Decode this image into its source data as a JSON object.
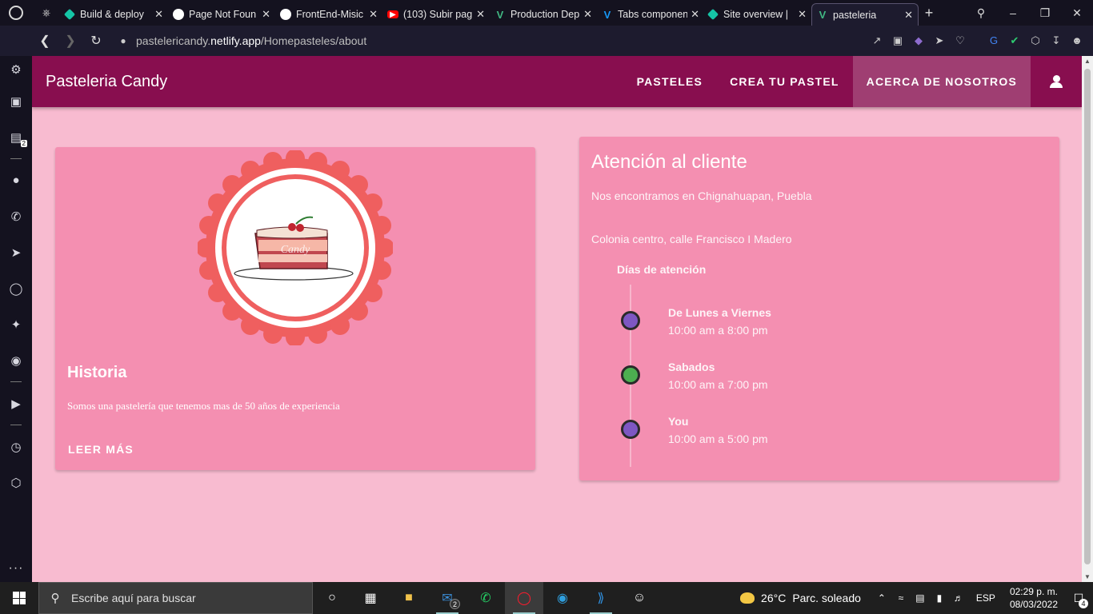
{
  "browser": {
    "tabs": [
      {
        "label": "Build & deploy",
        "icon": "netlify-icon",
        "color": "#15c5a6"
      },
      {
        "label": "Page Not Foun",
        "icon": "globe-icon",
        "color": "#ffffff"
      },
      {
        "label": "FrontEnd-Misic",
        "icon": "github-icon",
        "color": "#ffffff"
      },
      {
        "label": "(103) Subir pag",
        "icon": "youtube-icon",
        "color": "#ff0000"
      },
      {
        "label": "Production Dep",
        "icon": "vue-icon",
        "color": "#41b883"
      },
      {
        "label": "Tabs componen",
        "icon": "vuetify-icon",
        "color": "#1697f6"
      },
      {
        "label": "Site overview |",
        "icon": "netlify-icon",
        "color": "#15c5a6"
      },
      {
        "label": "pasteleria",
        "icon": "vue-icon",
        "color": "#41b883"
      }
    ],
    "url_prefix": "pastelericandy.",
    "url_host": "netlify.app",
    "url_path": "/Homepasteles/about"
  },
  "sidebar": {
    "twitch_badge": "2"
  },
  "app": {
    "brand": "Pasteleria Candy",
    "nav": {
      "pasteles": "PASTELES",
      "crea": "CREA TU PASTEL",
      "acerca": "ACERCA DE NOSOTROS"
    },
    "primary_color": "#880e4f",
    "background_color": "#f8bbd0",
    "card_color": "#f48fb1"
  },
  "historia": {
    "logo_text": "Candy",
    "title": "Historia",
    "text": "Somos una pastelería que tenemos mas de 50 años de experiencia",
    "button": "LEER MÁS"
  },
  "atencion": {
    "title": "Atención al cliente",
    "line1": "Nos encontramos en Chignahuapan, Puebla",
    "line2": "Colonia centro, calle Francisco I Madero",
    "schedule_title": "Días de atención",
    "schedule": [
      {
        "day": "De Lunes a Viernes",
        "hours": "10:00 am a 8:00 pm",
        "color": "#7e57c2"
      },
      {
        "day": "Sabados",
        "hours": "10:00 am a 7:00 pm",
        "color": "#4caf50"
      },
      {
        "day": "You",
        "hours": "10:00 am a 5:00 pm",
        "color": "#7e57c2"
      }
    ]
  },
  "taskbar": {
    "search_placeholder": "Escribe aquí para buscar",
    "mail_badge": "2",
    "temperature": "26°C",
    "weather": "Parc. soleado",
    "language": "ESP",
    "time": "02:29 p. m.",
    "date": "08/03/2022",
    "notifications": "4"
  }
}
